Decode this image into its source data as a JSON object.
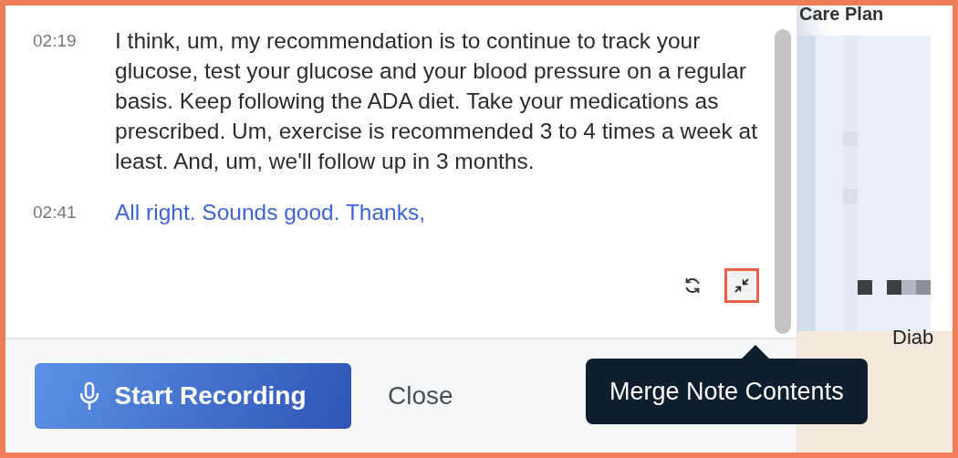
{
  "transcript": [
    {
      "time": "02:19",
      "kind": "provider",
      "text": "I think, um, my recommendation is to continue to track your glucose, test your glucose and your blood pressure on a regular basis. Keep following the ADA diet. Take your medications as prescribed. Um, exercise is recommended 3 to 4 times a week at least. And, um, we'll follow up in 3 months."
    },
    {
      "time": "02:41",
      "kind": "patient",
      "text": "All right. Sounds good. Thanks,"
    }
  ],
  "tooltip": {
    "text": "Merge Note Contents"
  },
  "footer": {
    "start_button": "Start Recording",
    "close_button": "Close"
  },
  "side_panel": {
    "title": "Care Plan",
    "label": "Diab"
  }
}
